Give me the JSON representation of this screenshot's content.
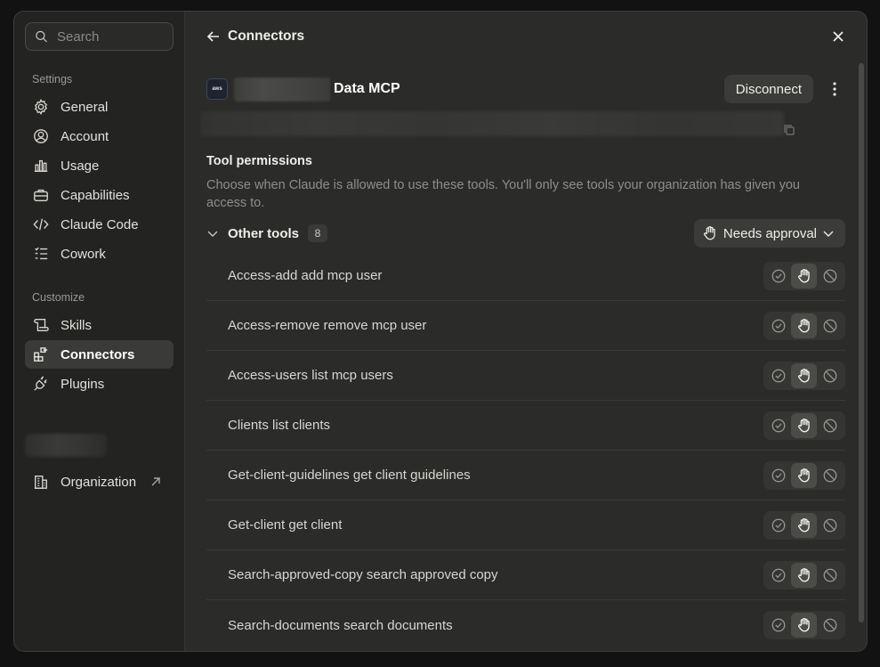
{
  "sidebar": {
    "search_placeholder": "Search",
    "settings_label": "Settings",
    "settings_items": [
      {
        "label": "General",
        "icon": "gear-icon"
      },
      {
        "label": "Account",
        "icon": "user-circle-icon"
      },
      {
        "label": "Usage",
        "icon": "bar-chart-icon"
      },
      {
        "label": "Capabilities",
        "icon": "briefcase-icon"
      },
      {
        "label": "Claude Code",
        "icon": "code-icon"
      },
      {
        "label": "Cowork",
        "icon": "list-icon"
      }
    ],
    "customize_label": "Customize",
    "customize_items": [
      {
        "label": "Skills",
        "icon": "scroll-icon"
      },
      {
        "label": "Connectors",
        "icon": "grid-plus-icon",
        "active": true
      },
      {
        "label": "Plugins",
        "icon": "plug-icon"
      }
    ],
    "organization_label": "Organization"
  },
  "header": {
    "back_label": "Connectors"
  },
  "connector": {
    "logo_text": "aws",
    "name": "Data MCP",
    "disconnect_label": "Disconnect"
  },
  "permissions": {
    "title": "Tool permissions",
    "description": "Choose when Claude is allowed to use these tools. You'll only see tools your organization has given you access to.",
    "group_label": "Other tools",
    "group_count": "8",
    "group_setting": "Needs approval",
    "tools": [
      {
        "name": "Access-add add mcp user",
        "mode": "needs-approval"
      },
      {
        "name": "Access-remove remove mcp user",
        "mode": "needs-approval"
      },
      {
        "name": "Access-users list mcp users",
        "mode": "needs-approval"
      },
      {
        "name": "Clients list clients",
        "mode": "needs-approval"
      },
      {
        "name": "Get-client-guidelines get client guidelines",
        "mode": "needs-approval"
      },
      {
        "name": "Get-client get client",
        "mode": "needs-approval"
      },
      {
        "name": "Search-approved-copy search approved copy",
        "mode": "needs-approval"
      },
      {
        "name": "Search-documents search documents",
        "mode": "needs-approval"
      }
    ]
  },
  "colors": {
    "background": "#121212",
    "window": "#2b2b2a",
    "sidebar": "#232322",
    "active_item": "#3a3a38"
  }
}
